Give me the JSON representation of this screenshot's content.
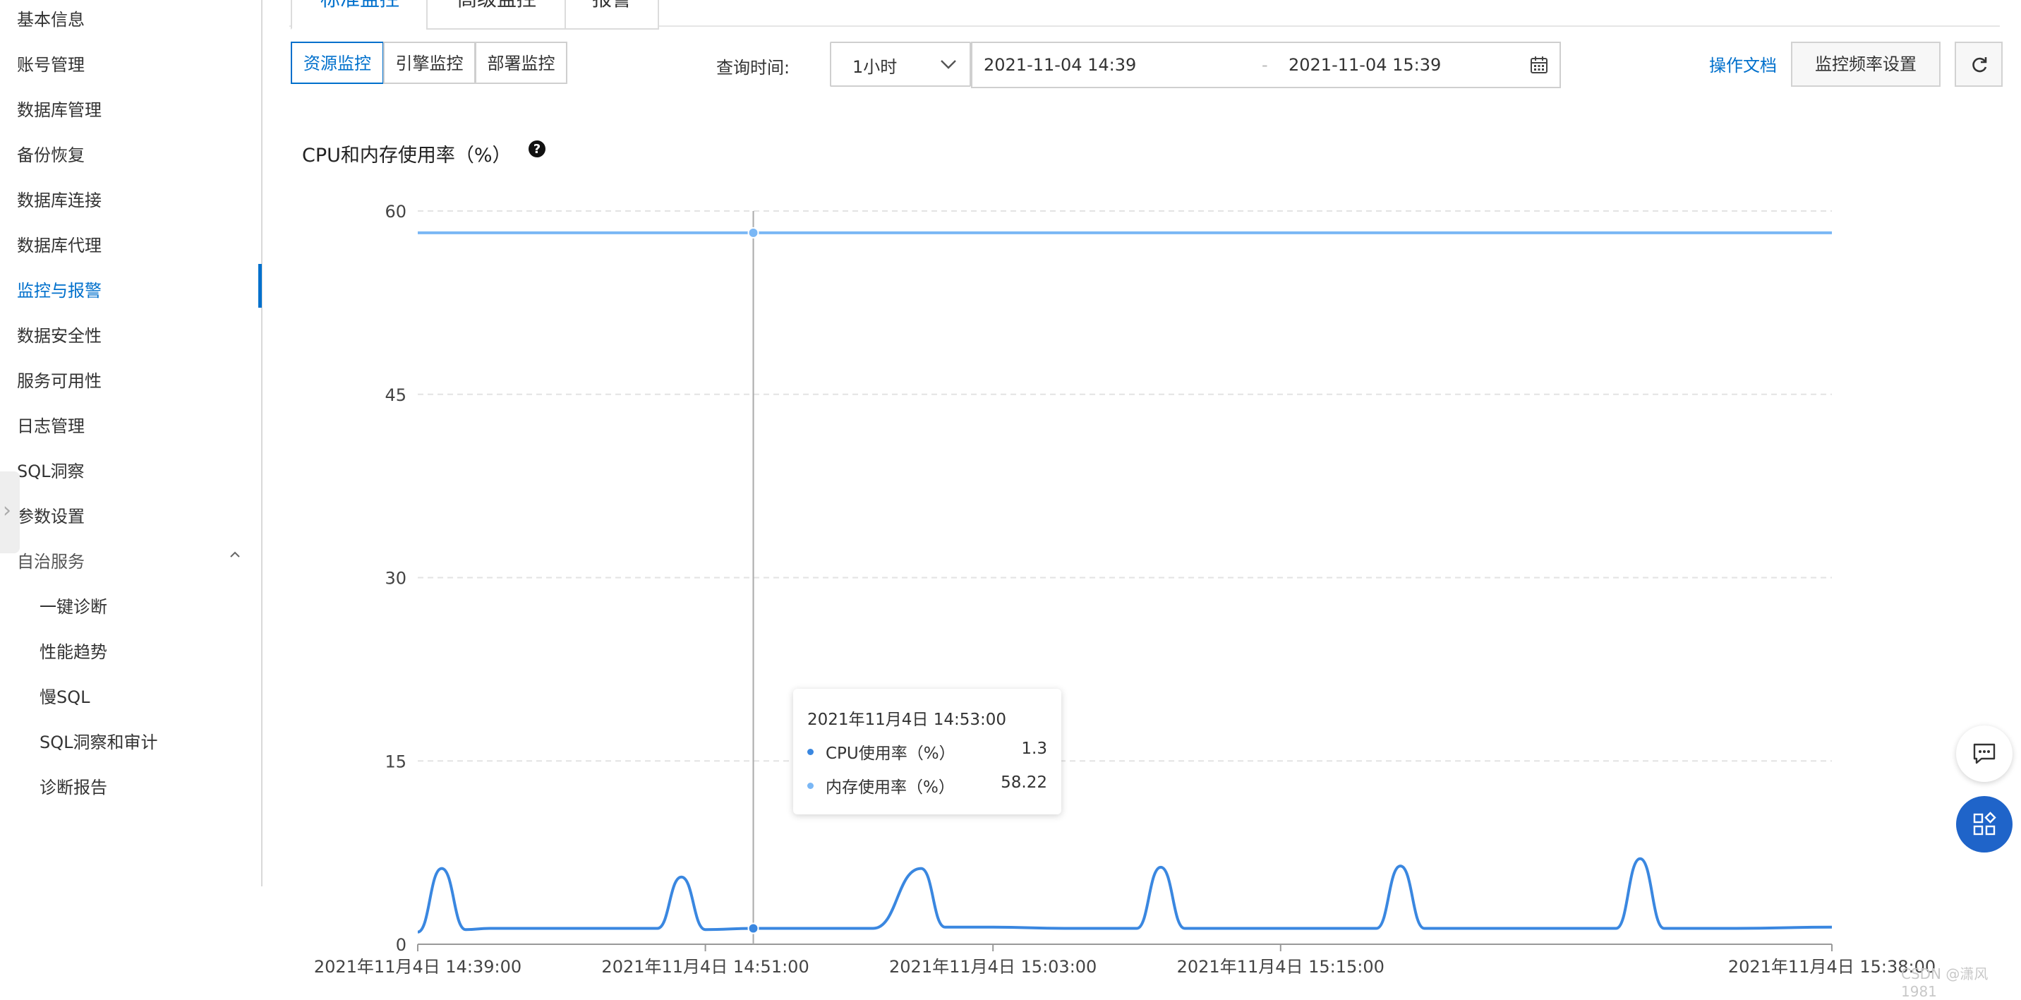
{
  "sidebar": {
    "items": [
      {
        "label": "基本信息"
      },
      {
        "label": "账号管理"
      },
      {
        "label": "数据库管理"
      },
      {
        "label": "备份恢复"
      },
      {
        "label": "数据库连接"
      },
      {
        "label": "数据库代理"
      },
      {
        "label": "监控与报警",
        "active": true
      },
      {
        "label": "数据安全性"
      },
      {
        "label": "服务可用性"
      },
      {
        "label": "日志管理"
      },
      {
        "label": "SQL洞察"
      },
      {
        "label": "参数设置"
      },
      {
        "label": "自治服务"
      }
    ],
    "sub_items": [
      {
        "label": "一键诊断"
      },
      {
        "label": "性能趋势"
      },
      {
        "label": "慢SQL"
      },
      {
        "label": "SQL洞察和审计"
      },
      {
        "label": "诊断报告"
      }
    ]
  },
  "tabs": [
    {
      "label": "标准监控",
      "active": true
    },
    {
      "label": "高级监控"
    },
    {
      "label": "报警"
    }
  ],
  "segments": [
    {
      "label": "资源监控",
      "active": true
    },
    {
      "label": "引擎监控"
    },
    {
      "label": "部署监控"
    }
  ],
  "query": {
    "label": "查询时间:",
    "range_select": "1小时",
    "start": "2021-11-04 14:39",
    "separator": "-",
    "end": "2021-11-04 15:39"
  },
  "actions": {
    "doc_link": "操作文档",
    "freq_button": "监控频率设置"
  },
  "chart_title": "CPU和内存使用率（%）",
  "chart_data": {
    "type": "line",
    "title": "CPU和内存使用率（%）",
    "ylim": [
      0,
      60
    ],
    "yticks": [
      0,
      15,
      30,
      45,
      60
    ],
    "xticks": [
      "2021年11月4日 14:39:00",
      "2021年11月4日 14:51:00",
      "2021年11月4日 15:03:00",
      "2021年11月4日 15:15:00",
      "2021年11月4日 15:38:00"
    ],
    "grid": true,
    "series": [
      {
        "name": "CPU使用率（%）",
        "color": "#3a87e0",
        "points": [
          {
            "t": "14:39:00",
            "v": 1.0
          },
          {
            "t": "14:40:00",
            "v": 6.2
          },
          {
            "t": "14:41:00",
            "v": 1.2
          },
          {
            "t": "14:42:00",
            "v": 1.3
          },
          {
            "t": "14:44:00",
            "v": 1.3
          },
          {
            "t": "14:46:00",
            "v": 1.3
          },
          {
            "t": "14:49:00",
            "v": 1.3
          },
          {
            "t": "14:50:00",
            "v": 5.5
          },
          {
            "t": "14:51:00",
            "v": 1.2
          },
          {
            "t": "14:53:00",
            "v": 1.3
          },
          {
            "t": "14:55:00",
            "v": 1.3
          },
          {
            "t": "14:58:00",
            "v": 1.3
          },
          {
            "t": "15:00:00",
            "v": 6.2
          },
          {
            "t": "15:01:00",
            "v": 1.4
          },
          {
            "t": "15:03:00",
            "v": 1.4
          },
          {
            "t": "15:06:00",
            "v": 1.3
          },
          {
            "t": "15:09:00",
            "v": 1.3
          },
          {
            "t": "15:10:00",
            "v": 6.3
          },
          {
            "t": "15:11:00",
            "v": 1.3
          },
          {
            "t": "15:14:00",
            "v": 1.3
          },
          {
            "t": "15:17:00",
            "v": 1.3
          },
          {
            "t": "15:19:00",
            "v": 1.3
          },
          {
            "t": "15:20:00",
            "v": 6.4
          },
          {
            "t": "15:21:00",
            "v": 1.3
          },
          {
            "t": "15:24:00",
            "v": 1.3
          },
          {
            "t": "15:27:00",
            "v": 1.3
          },
          {
            "t": "15:29:00",
            "v": 1.3
          },
          {
            "t": "15:30:00",
            "v": 7.0
          },
          {
            "t": "15:31:00",
            "v": 1.3
          },
          {
            "t": "15:34:00",
            "v": 1.3
          },
          {
            "t": "15:38:00",
            "v": 1.4
          }
        ]
      },
      {
        "name": "内存使用率（%）",
        "color": "#7ab7f5",
        "points": [
          {
            "t": "14:39:00",
            "v": 58.22
          },
          {
            "t": "14:53:00",
            "v": 58.22
          },
          {
            "t": "15:38:00",
            "v": 58.22
          }
        ]
      }
    ],
    "cursor_time": "14:53:00"
  },
  "tooltip": {
    "title": "2021年11月4日 14:53:00",
    "rows": [
      {
        "name": "CPU使用率（%）",
        "value": "1.3",
        "color": "#3a87e0"
      },
      {
        "name": "内存使用率（%）",
        "value": "58.22",
        "color": "#7ab7f5"
      }
    ]
  },
  "watermark": "CSDN @潇风1981",
  "colors": {
    "accent": "#0070cc",
    "cpu": "#3a87e0",
    "memory": "#7ab7f5",
    "float_primary": "#1f64c9"
  }
}
